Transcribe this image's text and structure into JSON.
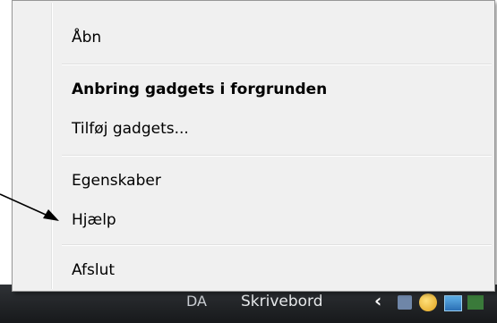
{
  "taskbar": {
    "language_label": "DA",
    "desktop_label": "Skrivebord",
    "chevron_glyph": "‹",
    "tray_icons": [
      "network-icon",
      "volume-icon",
      "display-icon",
      "app-icon"
    ]
  },
  "context_menu": {
    "items": [
      {
        "label": "Åbn",
        "bold": false
      },
      {
        "label": "Anbring gadgets i forgrunden",
        "bold": true
      },
      {
        "label": "Tilføj gadgets...",
        "bold": false
      },
      {
        "label": "Egenskaber",
        "bold": false
      },
      {
        "label": "Hjælp",
        "bold": false
      },
      {
        "label": "Afslut",
        "bold": false
      }
    ]
  },
  "colors": {
    "menu_background": "#f0f0f0",
    "menu_border": "#979797",
    "taskbar": "#1f2124",
    "annotation_arrow": "#000000"
  }
}
